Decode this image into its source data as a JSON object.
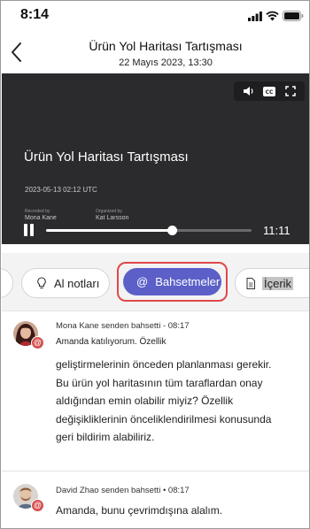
{
  "status_bar": {
    "time": "8:14"
  },
  "header": {
    "title": "Ürün Yol Haritası Tartışması",
    "subtitle": "22 Mayıs 2023, 13:30"
  },
  "video": {
    "title": "Ürün Yol Haritası Tartışması",
    "date": "2023-05-13 02:12 UTC",
    "recorded_by_label": "Recorded by",
    "organized_by_label": "Organized by",
    "recorded_by": "Mona Kane",
    "organized_by": "Kat Larsson",
    "duration": "11:11",
    "progress": 0.61,
    "controls": [
      "volume-icon",
      "captions-icon",
      "fullscreen-icon"
    ]
  },
  "tabs": {
    "notes_label": "Al notları",
    "mentions_label": "Bahsetmeler",
    "content_label": "İçerik",
    "active": "mentions",
    "accent": "#5b5fc7",
    "highlight": "#e0484a"
  },
  "mentions": [
    {
      "header": "Mona Kane senden bahsetti - 08:17",
      "first_line": "Amanda katılıyorum. Özellik",
      "body": "geliştirmelerinin önceden planlanması gerekir. Bu ürün yol haritasının tüm taraflardan onay aldığından emin olabilir miyiz? Özellik değişikliklerinin önceliklendirilmesi konusunda geri bildirim alabiliriz.",
      "badge": "@"
    },
    {
      "header": "David Zhao senden bahsetti • 08:17",
      "body": "Amanda, bunu çevrimdışına alalım.",
      "badge": "@"
    }
  ]
}
